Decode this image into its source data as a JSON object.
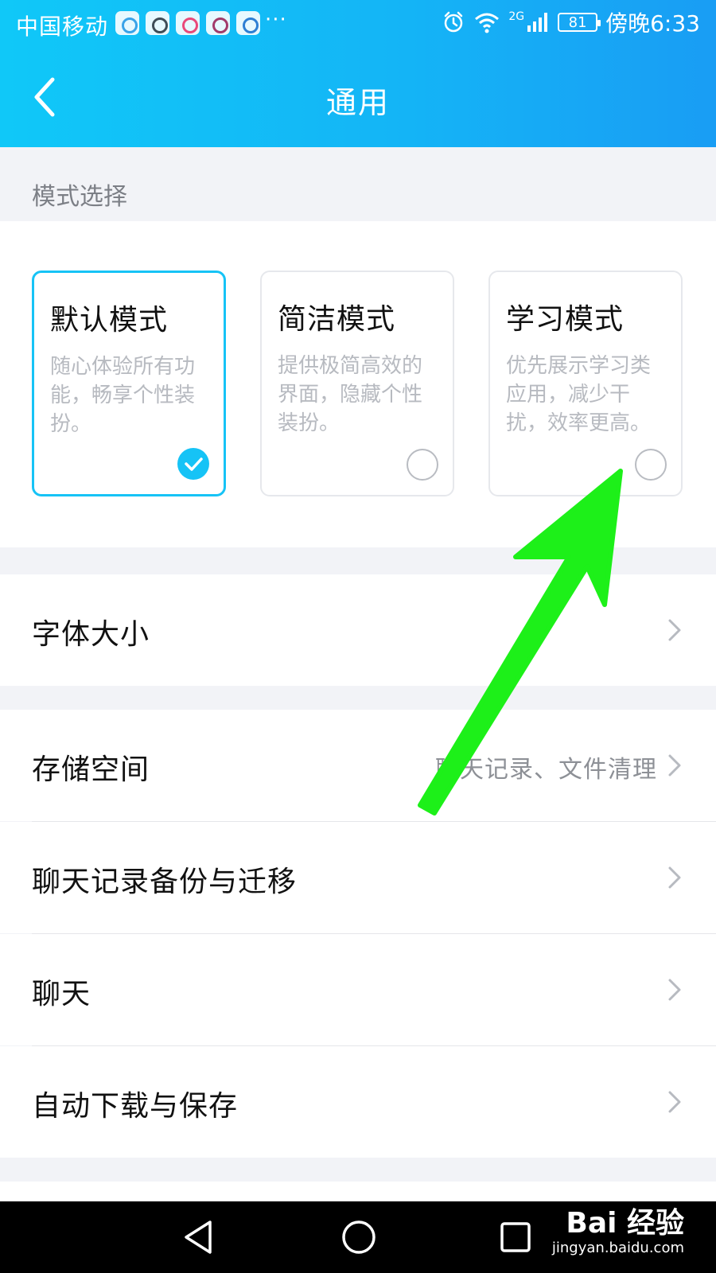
{
  "status_bar": {
    "carrier": "中国移动",
    "more": "···",
    "network": "2G",
    "battery": "81",
    "time": "傍晚6:33"
  },
  "header": {
    "title": "通用"
  },
  "mode_section": {
    "label": "模式选择",
    "modes": [
      {
        "title": "默认模式",
        "description": "随心体验所有功能，畅享个性装扮。",
        "selected": true
      },
      {
        "title": "简洁模式",
        "description": "提供极简高效的界面，隐藏个性装扮。",
        "selected": false
      },
      {
        "title": "学习模式",
        "description": "优先展示学习类应用，减少干扰，效率更高。",
        "selected": false
      }
    ]
  },
  "settings": {
    "font_size": {
      "label": "字体大小"
    },
    "storage": {
      "label": "存储空间",
      "value": "聊天记录、文件清理"
    },
    "backup": {
      "label": "聊天记录备份与迁移"
    },
    "chat": {
      "label": "聊天"
    },
    "auto_download": {
      "label": "自动下载与保存"
    }
  },
  "watermark": {
    "brand": "Bai 经验",
    "url": "jingyan.baidu.com"
  },
  "colors": {
    "header_start": "#10c8f8",
    "header_end": "#199df4",
    "accent": "#16c3f6",
    "annotation": "#1df019"
  }
}
